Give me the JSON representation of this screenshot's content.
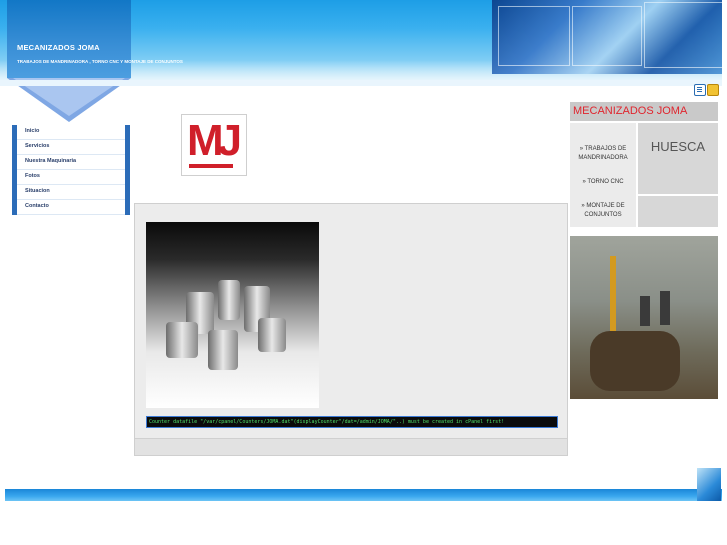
{
  "header": {
    "brand_title": "MECANIZADOS JOMA",
    "brand_subtitle": "TRABAJOS DE MANDRINADORA , TORNO CNC Y MONTAJE DE CONJUNTOS"
  },
  "top_icons": [
    "document-icon",
    "folder-icon"
  ],
  "nav": {
    "items": [
      {
        "label": "Inicio"
      },
      {
        "label": "Servicios"
      },
      {
        "label": "Nuestra Maquinaria"
      },
      {
        "label": "Fotos"
      },
      {
        "label": "Situacion"
      },
      {
        "label": "Contacto"
      }
    ]
  },
  "logo": {
    "letters": "MJ"
  },
  "main": {
    "counter_text": "Counter datafile \"/var/cpanel/Counters/JOMA.dat\"(displayCounter\"/dat=/admin/JOMA/\"..) must be created in cPanel first!"
  },
  "right_panel": {
    "title": "MECANIZADOS JOMA",
    "services": [
      {
        "label": "» TRABAJOS DE MANDRINADORA"
      },
      {
        "label": "» TORNO CNC"
      },
      {
        "label": "» MONTAJE DE CONJUNTOS"
      }
    ],
    "location": "HUESCA"
  },
  "colors": {
    "header_blue": "#1d9ee6",
    "nav_blue": "#2c6cb8",
    "brand_red": "#d01f2a"
  }
}
